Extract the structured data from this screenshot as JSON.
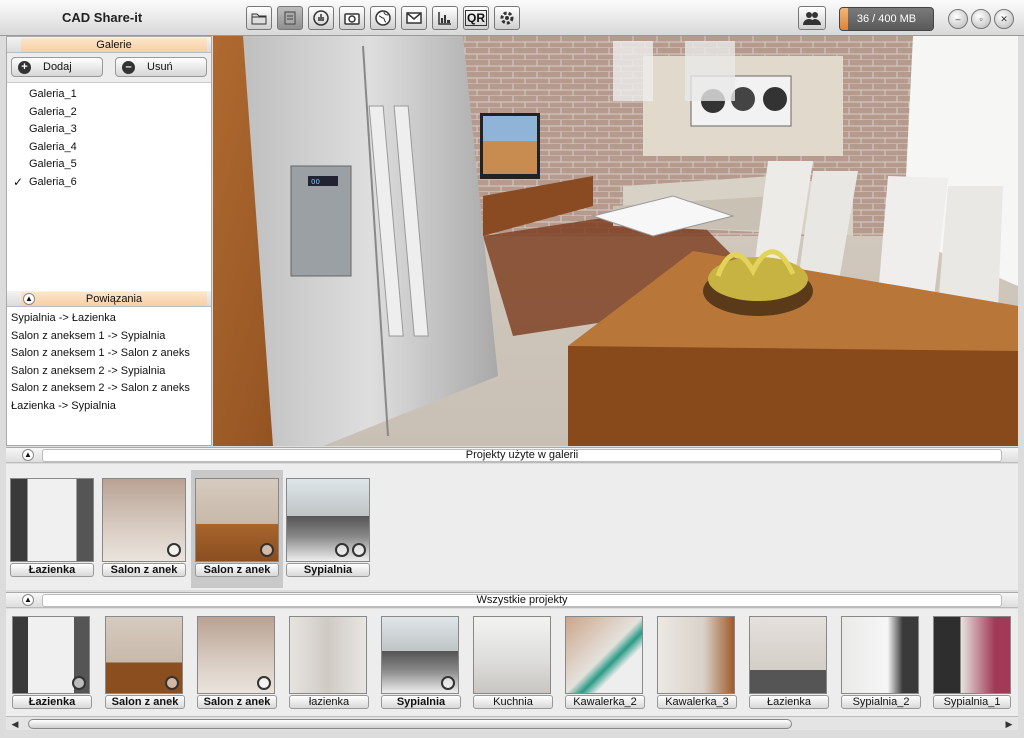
{
  "app": {
    "title": "CAD Share-it"
  },
  "toolbar": {
    "icons": [
      "folder-icon",
      "document-icon",
      "touch-icon",
      "camera-icon",
      "globe-icon",
      "mail-icon",
      "chart-icon",
      "qr-icon",
      "gear-icon"
    ],
    "qr_label": "QR"
  },
  "storage": {
    "label": "36 / 400 MB",
    "used": 36,
    "total": 400
  },
  "galleries": {
    "header": "Galerie",
    "add_label": "Dodaj",
    "remove_label": "Usuń",
    "items": [
      "Galeria_1",
      "Galeria_2",
      "Galeria_3",
      "Galeria_4",
      "Galeria_5",
      "Galeria_6"
    ],
    "checked": "Galeria_6"
  },
  "relations": {
    "header": "Powiązania",
    "items": [
      "Sypialnia -> Łazienka",
      "Salon z aneksem 1 -> Sypialnia",
      "Salon z aneksem 1 -> Salon z aneks",
      "Salon z aneksem 2 -> Sypialnia",
      "Salon z aneksem 2 -> Salon z aneks",
      "Łazienka -> Sypialnia"
    ]
  },
  "gallery_projects": {
    "title": "Projekty użyte w galerii",
    "items": [
      "Łazienka",
      "Salon z anek",
      "Salon z anek",
      "Sypialnia"
    ],
    "selected_index": 2
  },
  "all_projects": {
    "title": "Wszystkie projekty",
    "items": [
      "Łazienka",
      "Salon z anek",
      "Salon z anek",
      "łazienka",
      "Sypialnia",
      "Kuchnia",
      "Kawalerka_2",
      "Kawalerka_3",
      "Łazienka",
      "Sypialnia_2",
      "Sypialnia_1"
    ]
  },
  "colors": {
    "accent": "#f7cfa3",
    "storage_fill": "#d9843a"
  }
}
